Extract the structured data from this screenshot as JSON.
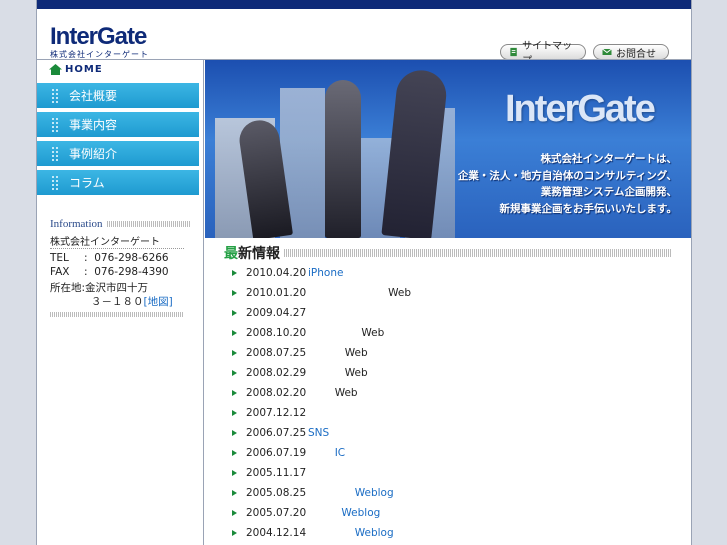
{
  "header": {
    "logo": "InterGate",
    "logo_sub": "株式会社インターゲート",
    "sitemap_label": "サイトマップ",
    "contact_label": "お問合せ"
  },
  "sidebar": {
    "home_label": "HOME",
    "items": [
      {
        "label": "会社概要"
      },
      {
        "label": "事業内容"
      },
      {
        "label": "事例紹介"
      },
      {
        "label": "コラム"
      }
    ],
    "info_heading": "Information",
    "company": "株式会社インターゲート",
    "tel_key": "TEL",
    "tel": "076-298-6266",
    "fax_key": "FAX",
    "fax": "076-298-4390",
    "addr_key": "所在地:",
    "addr1": "金沢市四十万",
    "addr2": "３－１８０",
    "map_link": "[地図]",
    "colon": ":"
  },
  "hero": {
    "logo": "InterGate",
    "lines": [
      "株式会社インターゲートは、",
      "企業・法人・地方自治体のコンサルティング、",
      "業務管理システム企画開発、",
      "新規事業企画をお手伝いいたします。"
    ]
  },
  "news": {
    "heading_first": "最",
    "heading_rest": "新情報",
    "items": [
      {
        "date": "2010.04.20",
        "pad": "",
        "text": "iPhone",
        "link": true
      },
      {
        "date": "2010.01.20",
        "pad": "                        ",
        "text": "Web",
        "link": false
      },
      {
        "date": "2009.04.27",
        "pad": "",
        "text": "",
        "link": false
      },
      {
        "date": "2008.10.20",
        "pad": "                ",
        "text": "Web",
        "link": false
      },
      {
        "date": "2008.07.25",
        "pad": "           ",
        "text": "Web",
        "link": false
      },
      {
        "date": "2008.02.29",
        "pad": "           ",
        "text": "Web",
        "link": false
      },
      {
        "date": "2008.02.20",
        "pad": "        ",
        "text": "Web",
        "link": false
      },
      {
        "date": "2007.12.12",
        "pad": "",
        "text": "",
        "link": false
      },
      {
        "date": "2006.07.25",
        "pad": "",
        "text": "SNS",
        "link": true
      },
      {
        "date": "2006.07.19",
        "pad": "        ",
        "text": "IC",
        "link": true
      },
      {
        "date": "2005.11.17",
        "pad": "",
        "text": "",
        "link": false
      },
      {
        "date": "2005.08.25",
        "pad": "              ",
        "text": "Weblog",
        "link": true
      },
      {
        "date": "2005.07.20",
        "pad": "          ",
        "text": "Weblog",
        "link": true
      },
      {
        "date": "2004.12.14",
        "pad": "              ",
        "text": "Weblog",
        "link": true
      }
    ]
  },
  "colors": {
    "brand": "#0e2a78",
    "nav": "#1e9ad0",
    "accent": "#25a045",
    "link": "#1a6cc4"
  }
}
